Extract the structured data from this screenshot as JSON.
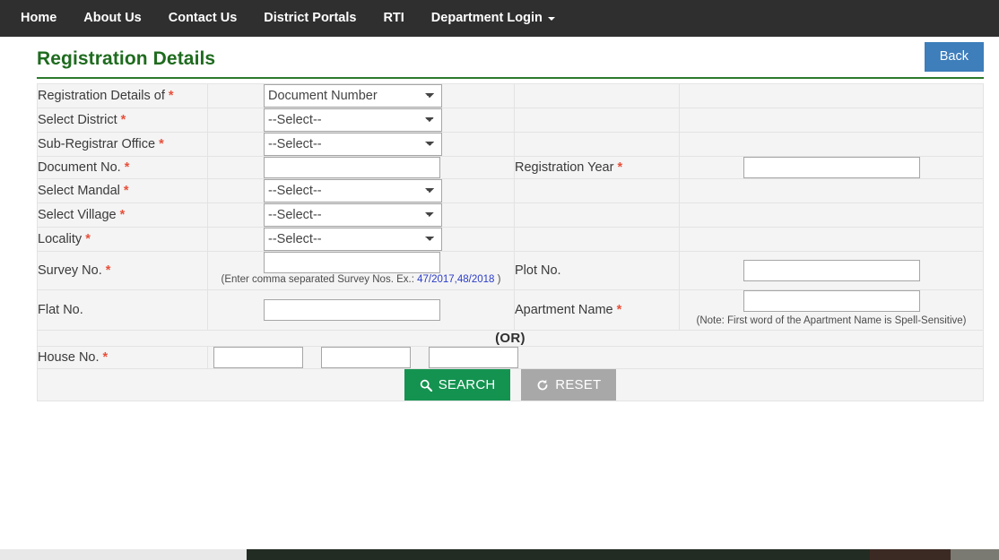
{
  "navbar": {
    "items": [
      {
        "label": "Home"
      },
      {
        "label": "About Us"
      },
      {
        "label": "Contact Us"
      },
      {
        "label": "District Portals"
      },
      {
        "label": "RTI"
      },
      {
        "label": "Department Login",
        "caret": true
      }
    ]
  },
  "header": {
    "title": "Registration Details",
    "back_label": "Back"
  },
  "form": {
    "rows": {
      "registration_details_of": {
        "label": "Registration Details of",
        "required": true,
        "value": "Document Number",
        "options": [
          "Document Number"
        ]
      },
      "select_district": {
        "label": "Select District",
        "required": true,
        "value": "--Select--",
        "options": [
          "--Select--"
        ]
      },
      "sub_registrar_office": {
        "label": "Sub-Registrar Office",
        "required": true,
        "value": "--Select--",
        "options": [
          "--Select--"
        ]
      },
      "document_no": {
        "label": "Document No.",
        "required": true,
        "value": ""
      },
      "registration_year": {
        "label": "Registration Year",
        "required": true,
        "value": ""
      },
      "select_mandal": {
        "label": "Select Mandal",
        "required": true,
        "value": "--Select--",
        "options": [
          "--Select--"
        ]
      },
      "select_village": {
        "label": "Select Village",
        "required": true,
        "value": "--Select--",
        "options": [
          "--Select--"
        ]
      },
      "locality": {
        "label": "Locality",
        "required": true,
        "required_no_space": true,
        "value": "--Select--",
        "options": [
          "--Select--"
        ]
      },
      "survey_no": {
        "label": "Survey No.",
        "required": true,
        "value": "",
        "hint_prefix": "(Enter comma separated Survey Nos. Ex.: ",
        "hint_example": "47/2017,48/2018",
        "hint_suffix": " )"
      },
      "plot_no": {
        "label": "Plot No.",
        "required": false,
        "value": ""
      },
      "flat_no": {
        "label": "Flat No.",
        "required": false,
        "value": ""
      },
      "apartment_name": {
        "label": "Apartment Name",
        "required": true,
        "required_no_space": true,
        "value": "",
        "note": "(Note: First word of the Apartment Name is Spell-Sensitive)"
      },
      "or_separator": {
        "label": "(OR)"
      },
      "house_no": {
        "label": "House No.",
        "required": true,
        "required_no_space": true,
        "value_1": "",
        "value_2": "",
        "value_3": ""
      }
    }
  },
  "actions": {
    "search_label": "SEARCH",
    "reset_label": "RESET"
  },
  "colors": {
    "navbar_bg": "#2f2f2f",
    "title_green": "#1f6b1f",
    "back_blue": "#3d7ebb",
    "search_green": "#149350",
    "reset_gray": "#a8a8a8",
    "required_red": "#e8503a",
    "hint_blue": "#2b3cc9",
    "table_bg": "#f4f4f4"
  }
}
